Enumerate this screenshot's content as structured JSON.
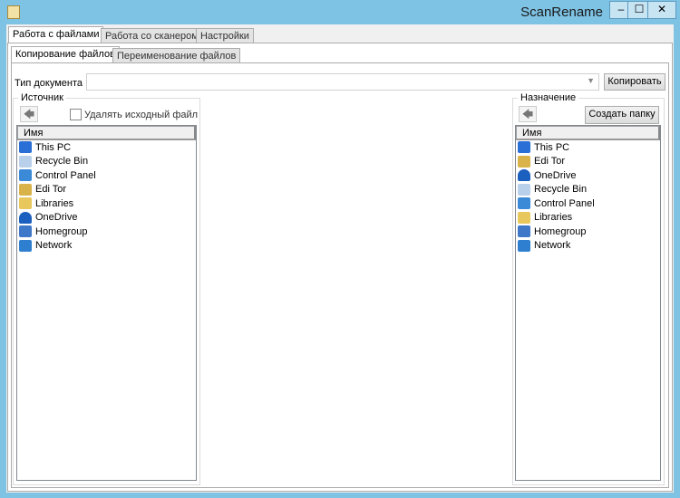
{
  "window": {
    "title": "ScanRename",
    "minimize": "–",
    "maximize": "☐",
    "close": "✕"
  },
  "tabs": [
    "Работа с файлами",
    "Работа со сканером",
    "Настройки"
  ],
  "subtabs": [
    "Копирование файлов",
    "Переименование файлов"
  ],
  "doc_type": {
    "label": "Тип документа",
    "value": "",
    "dropdown": "▼"
  },
  "copy_button": "Копировать",
  "source": {
    "title": "Источник",
    "back": "🡄",
    "delete_checkbox": "Удалять исходный файл",
    "delete_checked": false,
    "column": "Имя",
    "items": [
      {
        "label": "This PC",
        "icon": "computer",
        "color": "#2a6fd6"
      },
      {
        "label": "Recycle Bin",
        "icon": "recycle-bin",
        "color": "#b9d0ea"
      },
      {
        "label": "Control Panel",
        "icon": "control-panel",
        "color": "#3a8ad8"
      },
      {
        "label": "Edi Tor",
        "icon": "user-folder",
        "color": "#d9b34a"
      },
      {
        "label": "Libraries",
        "icon": "libraries",
        "color": "#e8c75c"
      },
      {
        "label": "OneDrive",
        "icon": "cloud",
        "color": "#1b5fbf"
      },
      {
        "label": "Homegroup",
        "icon": "homegroup",
        "color": "#3f78c8"
      },
      {
        "label": "Network",
        "icon": "network",
        "color": "#2e7fd0"
      }
    ]
  },
  "destination": {
    "title": "Назначение",
    "back": "🡄",
    "create_folder": "Создать папку",
    "column": "Имя",
    "items": [
      {
        "label": "This PC",
        "icon": "computer",
        "color": "#2a6fd6"
      },
      {
        "label": "Edi Tor",
        "icon": "user-folder",
        "color": "#d9b34a"
      },
      {
        "label": "OneDrive",
        "icon": "cloud",
        "color": "#1b5fbf"
      },
      {
        "label": "Recycle Bin",
        "icon": "recycle-bin",
        "color": "#b9d0ea"
      },
      {
        "label": "Control Panel",
        "icon": "control-panel",
        "color": "#3a8ad8"
      },
      {
        "label": "Libraries",
        "icon": "libraries",
        "color": "#e8c75c"
      },
      {
        "label": "Homegroup",
        "icon": "homegroup",
        "color": "#3f78c8"
      },
      {
        "label": "Network",
        "icon": "network",
        "color": "#2e7fd0"
      }
    ]
  }
}
